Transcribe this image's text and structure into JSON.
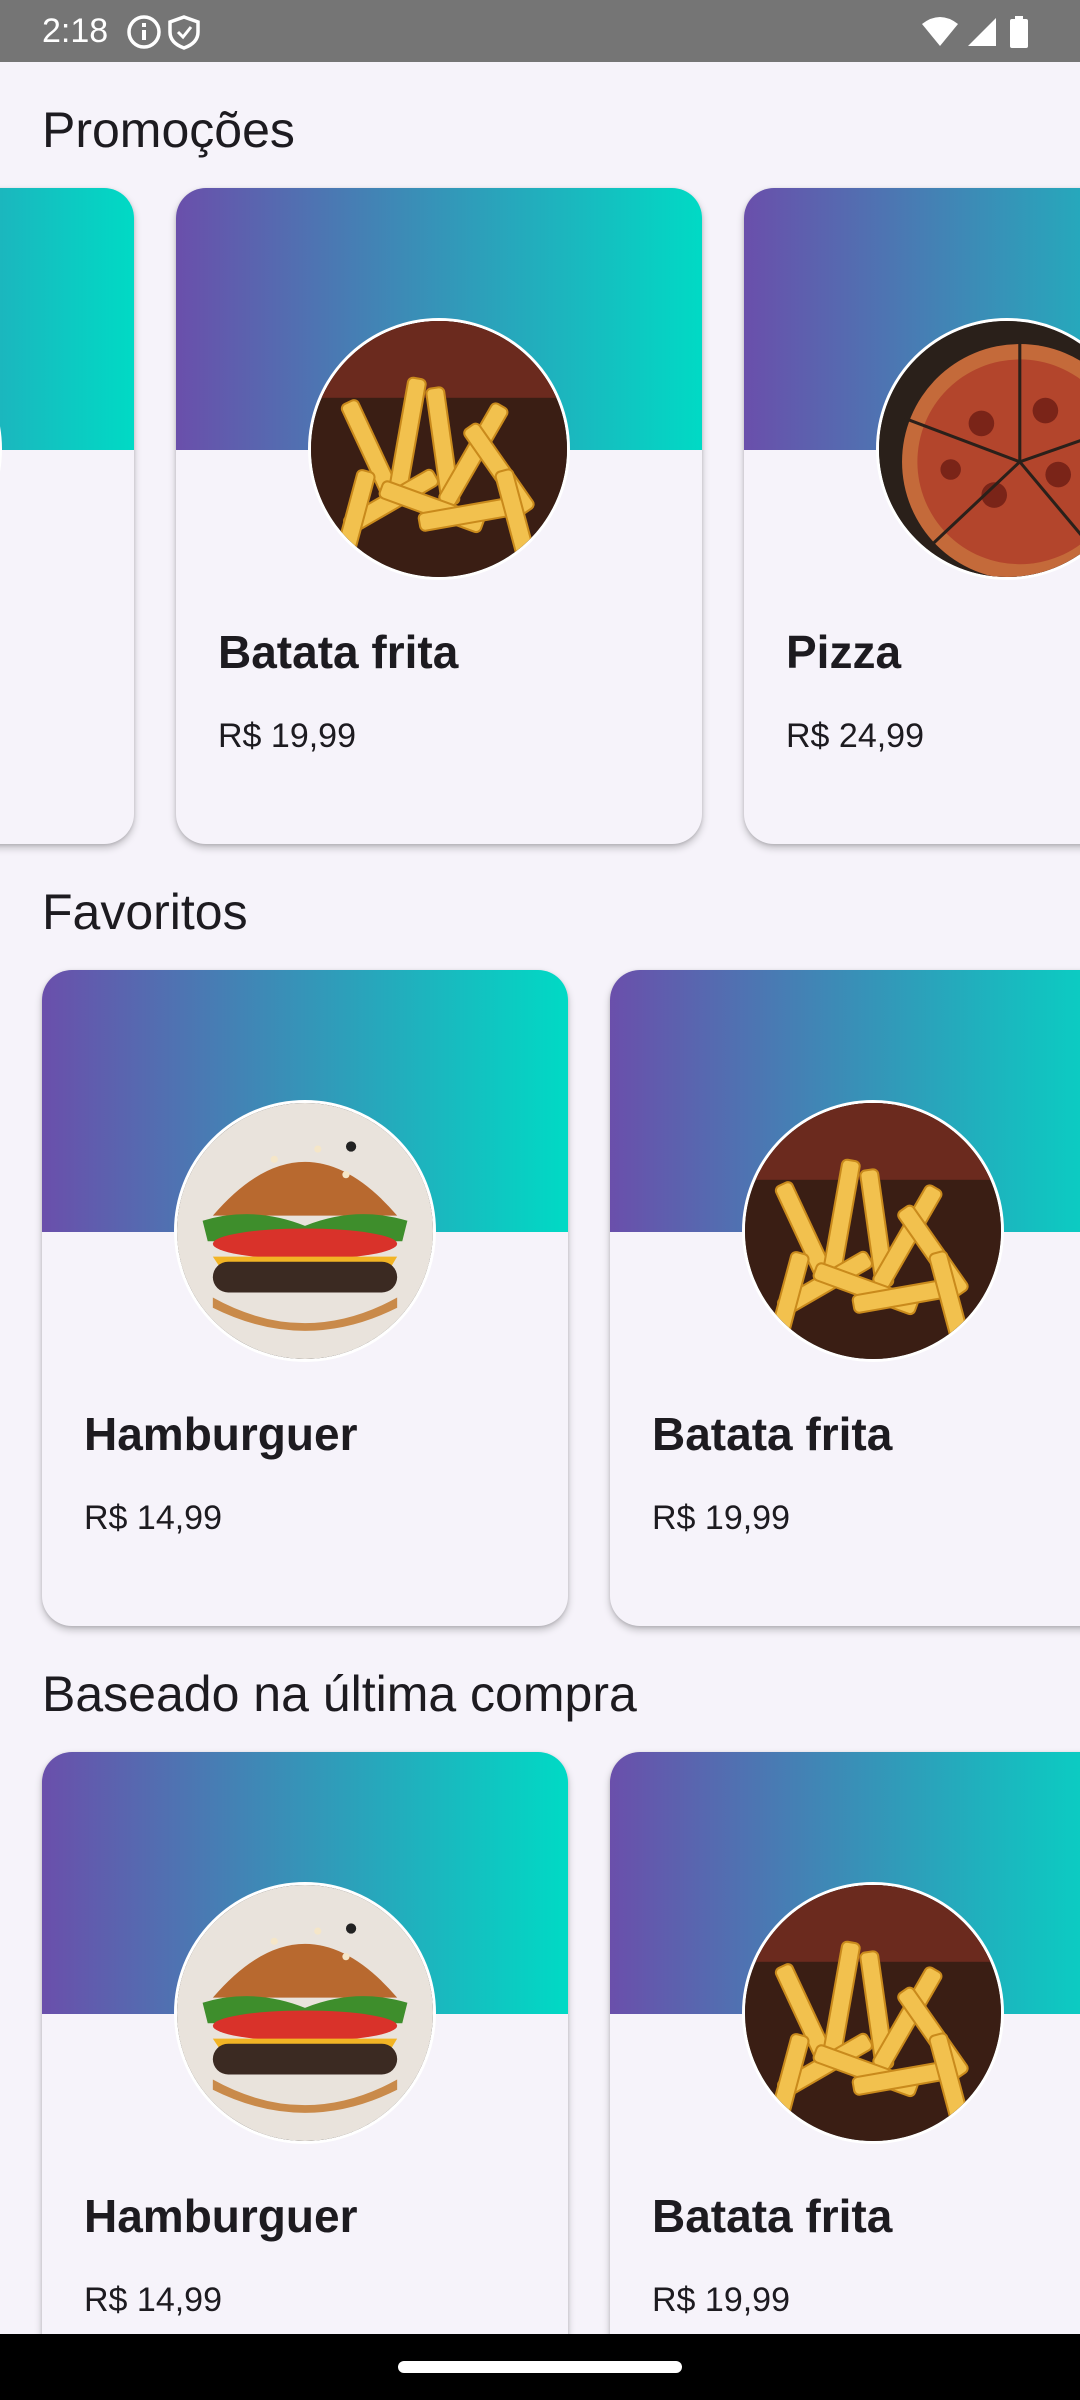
{
  "status_bar": {
    "time": "2:18",
    "left_icons": [
      "info-icon",
      "shield-icon"
    ],
    "right_icons": [
      "wifi-icon",
      "signal-icon",
      "battery-icon"
    ]
  },
  "colors": {
    "gradient_start": "#6a4fab",
    "gradient_end": "#00dac5",
    "background": "#f6f3fa",
    "text": "#1d1b20"
  },
  "sections": [
    {
      "title": "Promoções",
      "cards": [
        {
          "name": "",
          "price": "",
          "image": "partial"
        },
        {
          "name": "Batata frita",
          "price": "R$ 19,99",
          "image": "fries"
        },
        {
          "name": "Pizza",
          "price": "R$ 24,99",
          "image": "pizza"
        }
      ]
    },
    {
      "title": "Favoritos",
      "cards": [
        {
          "name": "Hamburguer",
          "price": "R$ 14,99",
          "image": "burger"
        },
        {
          "name": "Batata frita",
          "price": "R$ 19,99",
          "image": "fries"
        }
      ]
    },
    {
      "title": "Baseado na última compra",
      "cards": [
        {
          "name": "Hamburguer",
          "price": "R$ 14,99",
          "image": "burger"
        },
        {
          "name": "Batata frita",
          "price": "R$ 19,99",
          "image": "fries"
        }
      ]
    }
  ]
}
